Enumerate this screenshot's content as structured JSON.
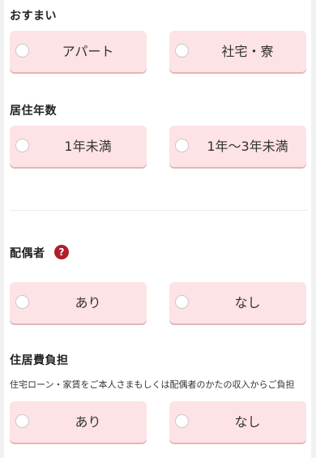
{
  "residence": {
    "title": "おすまい",
    "options": [
      "アパート",
      "社宅・寮"
    ]
  },
  "years": {
    "title": "居住年数",
    "options": [
      "1年未満",
      "1年〜3年未満"
    ]
  },
  "spouse": {
    "title": "配偶者",
    "help_icon": "?",
    "options": [
      "あり",
      "なし"
    ]
  },
  "housing_cost": {
    "title": "住居費負担",
    "note": "住宅ローン・家賃をご本人さまもしくは配偶者のかたの収入からご負担",
    "options": [
      "あり",
      "なし"
    ]
  },
  "colors": {
    "option_bg": "#fde3e5",
    "help_icon": "#b01e2b"
  }
}
